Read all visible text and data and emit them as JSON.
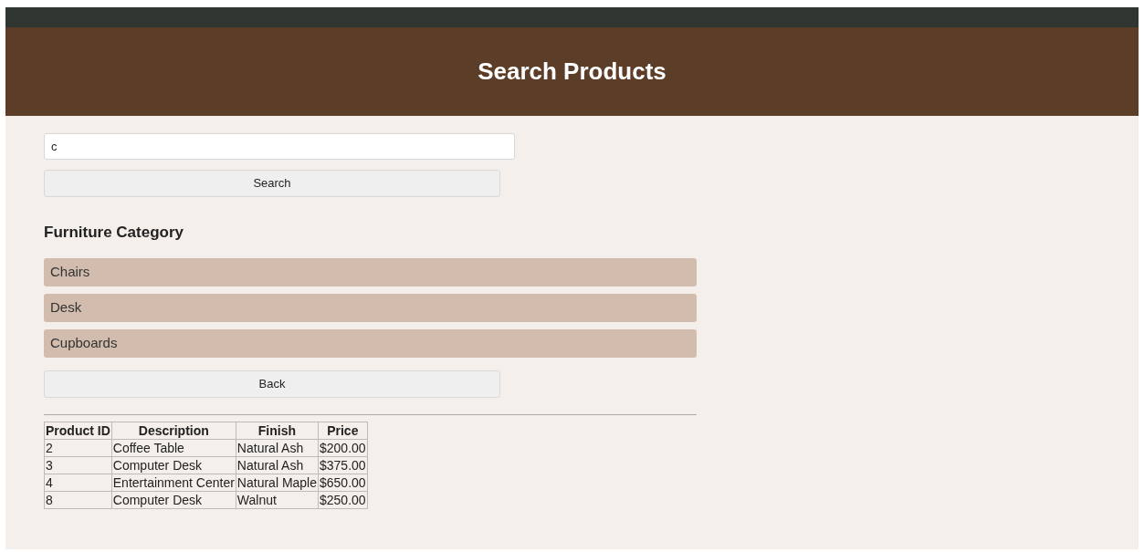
{
  "header": {
    "title": "Search Products"
  },
  "search": {
    "value": "c",
    "button": "Search"
  },
  "category": {
    "heading": "Furniture Category",
    "items": [
      "Chairs",
      "Desk",
      "Cupboards"
    ]
  },
  "back_button": "Back",
  "table": {
    "columns": [
      "Product ID",
      "Description",
      "Finish",
      "Price"
    ],
    "rows": [
      [
        "2",
        "Coffee Table",
        "Natural Ash",
        "$200.00"
      ],
      [
        "3",
        "Computer Desk",
        "Natural Ash",
        "$375.00"
      ],
      [
        "4",
        "Entertainment Center",
        "Natural Maple",
        "$650.00"
      ],
      [
        "8",
        "Computer Desk",
        "Walnut",
        "$250.00"
      ]
    ]
  }
}
